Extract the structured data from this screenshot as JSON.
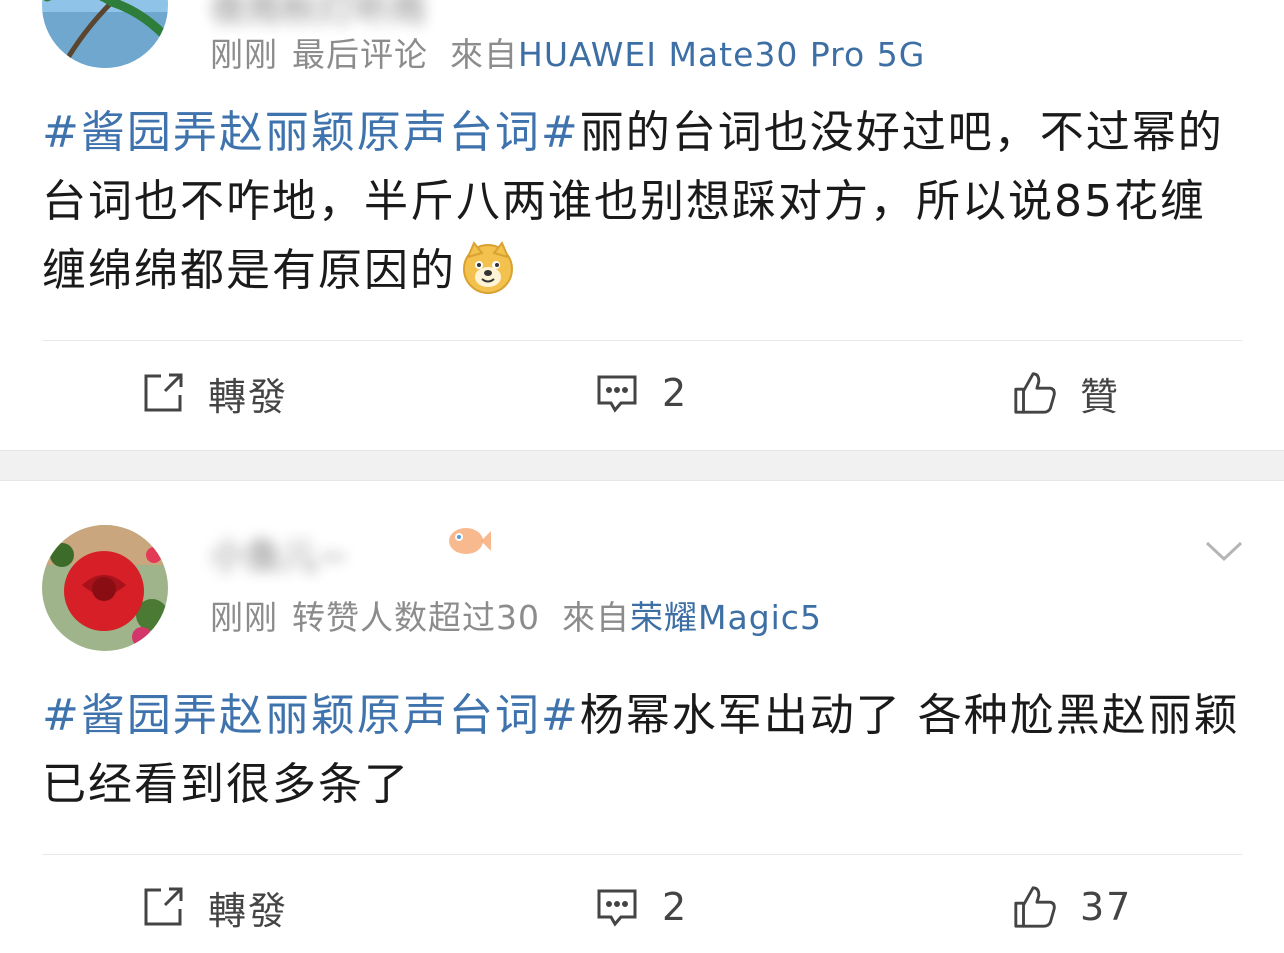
{
  "comments": [
    {
      "username": "夜雨秋灯听雨",
      "meta": {
        "time": "刚刚",
        "tag": "最后评论",
        "from_label": "來自",
        "source": "HUAWEI Mate30 Pro 5G"
      },
      "hashtag": "#酱园弄赵丽颖原声台词#",
      "text": "丽的台词也没好过吧，不过幂的台词也不咋地，半斤八两谁也别想踩对方，所以说85花缠缠绵绵都是有原因的",
      "emoji": "doge-emoji",
      "actions": {
        "repost": "轉發",
        "comments": "2",
        "likes": "贊"
      }
    },
    {
      "username": "小鱼儿~",
      "meta": {
        "time": "刚刚",
        "tag": "转赞人数超过30",
        "from_label": "來自",
        "source": "荣耀Magic5"
      },
      "hashtag": "#酱园弄赵丽颖原声台词#",
      "text": "杨幂水军出动了 各种尬黑赵丽颖 已经看到很多条了",
      "actions": {
        "repost": "轉發",
        "comments": "2",
        "likes": "37"
      }
    }
  ],
  "icons": {
    "repost": "edit-share-icon",
    "comment": "comment-bubble-icon",
    "like": "thumbs-up-icon",
    "more": "chevron-down-icon"
  },
  "colors": {
    "link": "#3f73ad",
    "meta": "#8c8c8c",
    "text": "#1a1a1a",
    "separator": "#f1f1f1"
  }
}
